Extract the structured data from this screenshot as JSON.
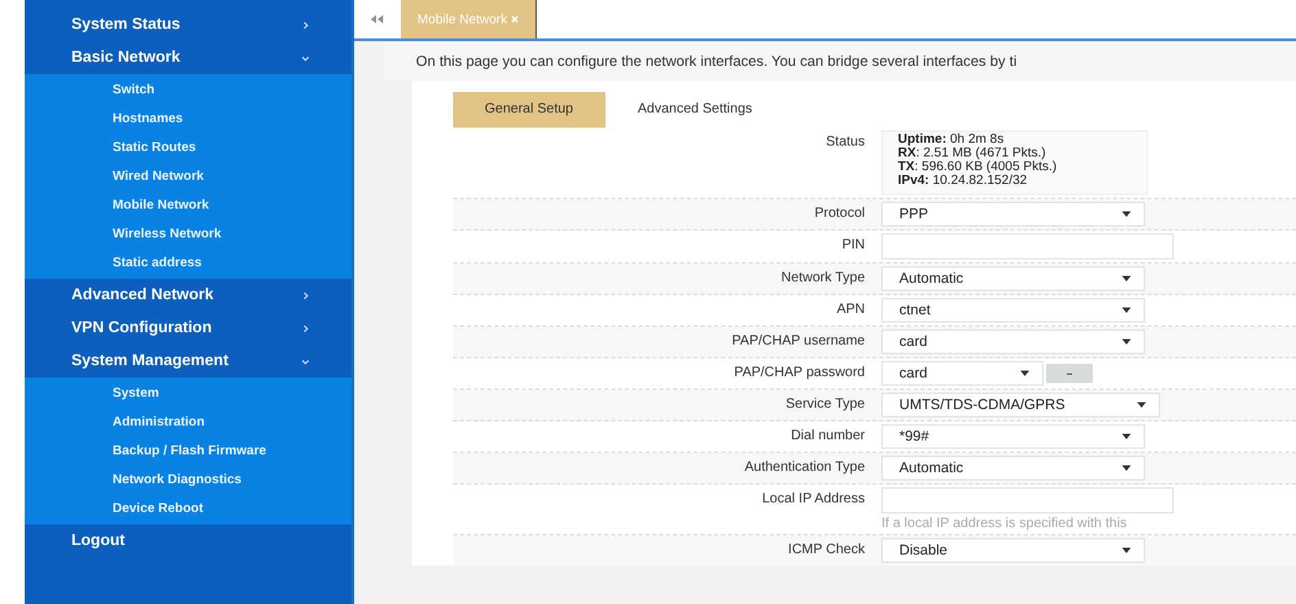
{
  "sidebar": {
    "items": [
      {
        "label": "System Status",
        "kind": "menu",
        "expanded": false
      },
      {
        "label": "Basic Network",
        "kind": "menu",
        "expanded": true,
        "children": [
          {
            "label": "Switch"
          },
          {
            "label": "Hostnames"
          },
          {
            "label": "Static Routes"
          },
          {
            "label": "Wired Network"
          },
          {
            "label": "Mobile Network"
          },
          {
            "label": "Wireless Network"
          },
          {
            "label": "Static address"
          }
        ]
      },
      {
        "label": "Advanced Network",
        "kind": "menu",
        "expanded": false
      },
      {
        "label": "VPN Configuration",
        "kind": "menu",
        "expanded": false
      },
      {
        "label": "System Management",
        "kind": "menu",
        "expanded": true,
        "children": [
          {
            "label": "System"
          },
          {
            "label": "Administration"
          },
          {
            "label": "Backup / Flash Firmware"
          },
          {
            "label": "Network Diagnostics"
          },
          {
            "label": "Device Reboot"
          }
        ]
      },
      {
        "label": "Logout",
        "kind": "link",
        "expanded": false
      }
    ]
  },
  "page_tabs": [
    {
      "label": "Mobile Network",
      "selected": true
    }
  ],
  "description": "On this page you can configure the network interfaces. You can bridge several interfaces by ti",
  "tabs": [
    {
      "label": "General Setup",
      "selected": true
    },
    {
      "label": "Advanced Settings",
      "selected": false
    }
  ],
  "form": [
    {
      "kind": "status",
      "label": "Status",
      "lines": [
        "**Uptime:** 0h 2m 8s",
        "**RX**: 2.51 MB (4671 Pkts.)",
        "**TX**: 596.60 KB (4005 Pkts.)",
        "**IPv4:** 10.24.82.152/32"
      ]
    },
    {
      "kind": "select",
      "label": "Protocol",
      "value": "PPP"
    },
    {
      "kind": "input",
      "label": "PIN"
    },
    {
      "kind": "select",
      "label": "Network Type",
      "value": "Automatic"
    },
    {
      "kind": "select",
      "label": "APN",
      "value": "ctnet"
    },
    {
      "kind": "select",
      "label": "PAP/CHAP username",
      "value": "card"
    },
    {
      "kind": "select_button",
      "label": "PAP/CHAP password",
      "value": "card"
    },
    {
      "kind": "select",
      "label": "Service Type",
      "value": "UMTS/TDS-CDMA/GPRS"
    },
    {
      "kind": "select",
      "label": "Dial number",
      "value": "*99#"
    },
    {
      "kind": "select",
      "label": "Authentication Type",
      "value": "Automatic"
    },
    {
      "kind": "input",
      "label": "Local IP Address",
      "hint": "If a local IP address is specified with this"
    },
    {
      "kind": "select",
      "label": "ICMP Check",
      "value": "Disable"
    }
  ]
}
